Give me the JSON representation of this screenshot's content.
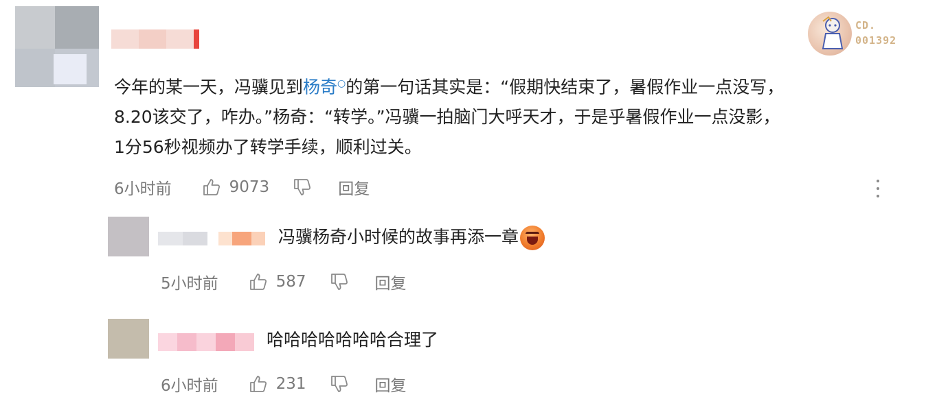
{
  "main_comment": {
    "text_before_link": "今年的某一天，冯骥见到",
    "link_text": "杨奇",
    "text_after_link_line1": "的第一句话其实是：“假期快结束了，暑假作业一点没写，",
    "text_line2": "8.20该交了，咋办。”杨奇：“转学。”冯骥一拍脑门大呼天才，于是乎暑假作业一点没影，",
    "text_line3": "1分56秒视频办了转学手续，顺利过关。",
    "time": "6小时前",
    "likes": "9073",
    "reply_label": "回复"
  },
  "badge": {
    "line1": "CD.",
    "line2": "001392"
  },
  "replies": [
    {
      "text": "冯骥杨奇小时候的故事再添一章",
      "time": "5小时前",
      "likes": "587",
      "reply_label": "回复"
    },
    {
      "text": "哈哈哈哈哈哈哈合理了",
      "time": "6小时前",
      "likes": "231",
      "reply_label": "回复"
    }
  ],
  "colors": {
    "link": "#2a7cc7",
    "meta_text": "#7a7a7a",
    "badge_text": "#d3b489"
  }
}
